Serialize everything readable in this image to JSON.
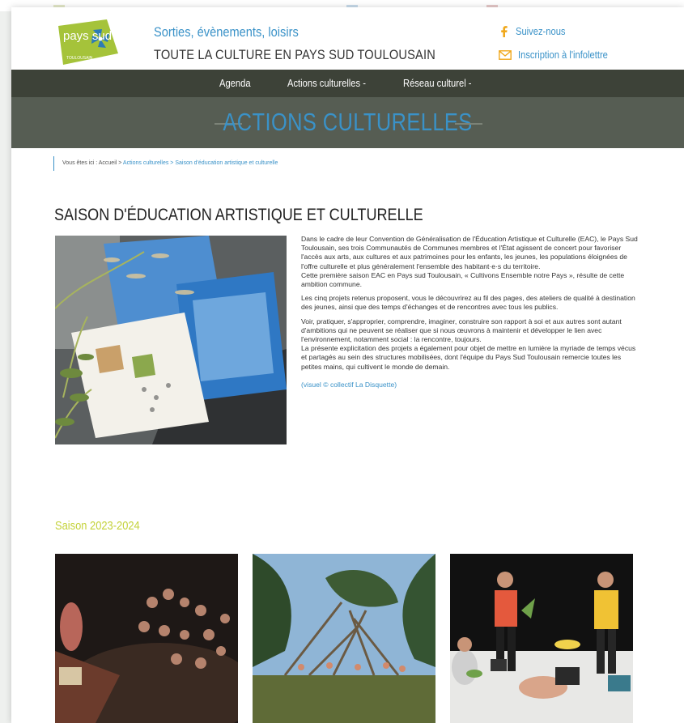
{
  "header": {
    "logo_text": "pays sud",
    "logo_small": "TOULOUSAIN",
    "tagline": "Sorties, évènements, loisirs",
    "subtitle": "TOUTE LA CULTURE EN PAYS SUD TOULOUSAIN",
    "follow": "Suivez-nous",
    "newsletter": "Inscription à l'infolettre"
  },
  "nav": {
    "items": [
      {
        "label": "Agenda"
      },
      {
        "label": "Actions culturelles -"
      },
      {
        "label": "Réseau culturel -"
      }
    ]
  },
  "banner": {
    "title": "ACTIONS CULTURELLES"
  },
  "breadcrumb": {
    "prefix": "Vous êtes ici : ",
    "home": "Accueil",
    "sep1": " > ",
    "section": "Actions culturelles",
    "sep2": " > ",
    "current": "Saison d'éducation artistique et culturelle"
  },
  "article": {
    "title": "SAISON D'ÉDUCATION ARTISTIQUE ET CULTURELLE",
    "p1": "Dans le cadre de leur Convention de Généralisation de l'Éducation Artistique et Culturelle (EAC), le Pays Sud Toulousain, ses trois Communautés de Communes membres et l'État agissent de concert pour favoriser l'accès aux arts, aux cultures et aux patrimoines pour les enfants, les jeunes, les populations éloignées de l'offre culturelle et plus généralement l'ensemble des habitant·e·s du territoire.",
    "p1b": "Cette première saison EAC en Pays sud Toulousain, « Cultivons Ensemble notre Pays », résulte de cette ambition commune.",
    "p2": "Les cinq projets retenus proposent, vous le découvrirez au fil des pages, des ateliers de qualité à destination des jeunes, ainsi que des temps d'échanges et de rencontres avec tous les publics.",
    "p3": "Voir, pratiquer, s'approprier, comprendre, imaginer, construire son rapport à soi et aux autres sont autant d'ambitions qui ne peuvent se réaliser que si nous œuvrons à maintenir et développer le lien avec l'environnement, notamment social : la rencontre, toujours.",
    "p3b": "La présente explicitation des projets a également pour objet de mettre en lumière la myriade de temps vécus et partagés au sein des structures mobilisées, dont l'équipe du Pays Sud Toulousain remercie toutes les petites mains, qui cultivent le monde de demain.",
    "credit": "(visuel © collectif La Disquette)"
  },
  "season": {
    "title": "Saison 2023-2024"
  },
  "colors": {
    "accent": "#3a92c8",
    "nav": "#3d4238",
    "banner": "#565d53",
    "season": "#c4d23a",
    "logo_green": "#a5c33a"
  }
}
